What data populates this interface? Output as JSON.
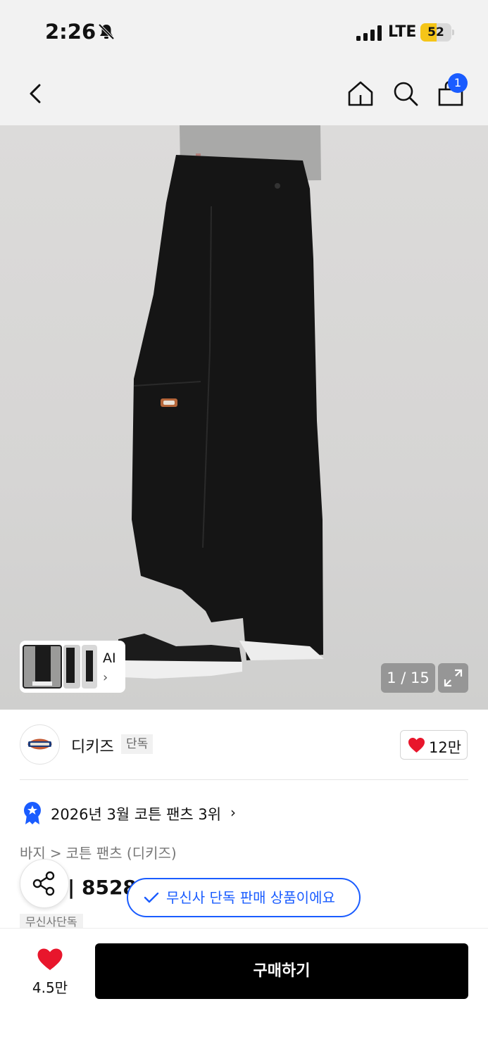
{
  "status_bar": {
    "time": "2:26",
    "network": "LTE",
    "battery": "52",
    "battery_level": 0.52
  },
  "nav": {
    "cart_count": "1"
  },
  "gallery": {
    "counter": "1 / 15",
    "ai_label": "AI"
  },
  "brand": {
    "name": "디키즈",
    "badge": "단독",
    "likes": "12만"
  },
  "ranking": {
    "text": "2026년 3월 코튼 팬츠 3위"
  },
  "breadcrumb": {
    "items": [
      "바지",
      ">",
      "코튼 팬츠 (디키즈)"
    ]
  },
  "product": {
    "title_partial": "| 8528",
    "exclusive_tag": "무신사단독"
  },
  "toast": {
    "text": "무신사 단독 판매 상품이에요"
  },
  "bottom_bar": {
    "wish_count": "4.5만",
    "buy_label": "구매하기"
  },
  "colors": {
    "accent_blue": "#1a5cff",
    "heart_red": "#e8162c",
    "buy_button": "#000000",
    "battery_yellow": "#f5c518"
  }
}
